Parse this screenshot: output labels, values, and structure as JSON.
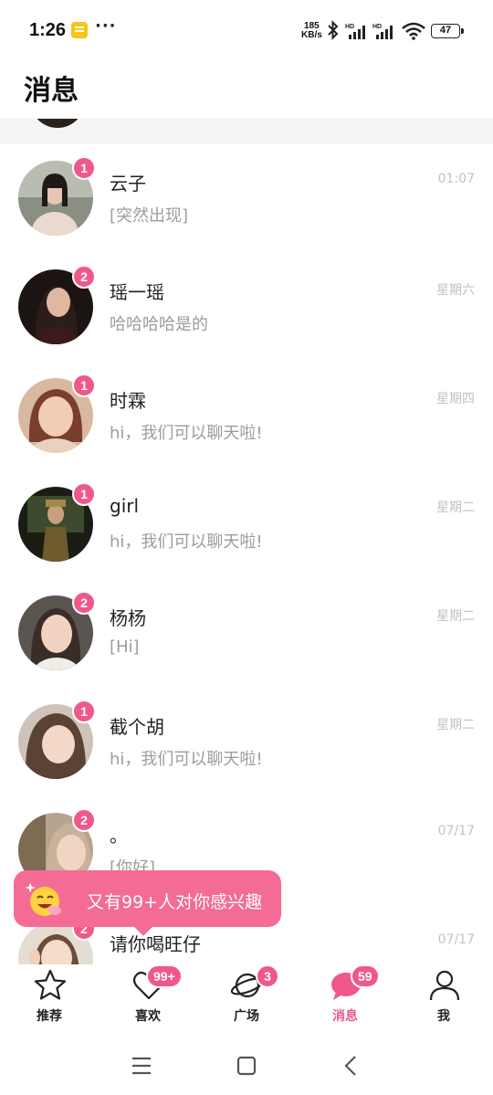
{
  "status_bar": {
    "time": "1:26",
    "dots": "···",
    "speed_value": "185",
    "speed_unit": "KB/s",
    "signal_label": "HD",
    "battery": "47"
  },
  "header": {
    "title": "消息"
  },
  "conversations": [
    {
      "name": "云子",
      "message": "[突然出现]",
      "time": "01:07",
      "unread": "1"
    },
    {
      "name": "瑶一瑶",
      "message": "哈哈哈哈是的",
      "time": "星期六",
      "unread": "2"
    },
    {
      "name": "时霖",
      "message": "hi，我们可以聊天啦!",
      "time": "星期四",
      "unread": "1"
    },
    {
      "name": "girl",
      "message": "hi，我们可以聊天啦!",
      "time": "星期二",
      "unread": "1"
    },
    {
      "name": "杨杨",
      "message": "[Hi]",
      "time": "星期二",
      "unread": "2"
    },
    {
      "name": "截个胡",
      "message": "hi，我们可以聊天啦!",
      "time": "星期二",
      "unread": "1"
    },
    {
      "name": "。",
      "message": "[你好]",
      "time": "07/17",
      "unread": "2"
    },
    {
      "name": "请你喝旺仔",
      "message": "",
      "time": "07/17",
      "unread": "2"
    }
  ],
  "toast": {
    "text": "又有99+人对你感兴趣"
  },
  "bottom_nav": {
    "items": [
      {
        "label": "推荐",
        "badge": "",
        "icon": "star-icon"
      },
      {
        "label": "喜欢",
        "badge": "99+",
        "icon": "heart-icon"
      },
      {
        "label": "广场",
        "badge": "3",
        "icon": "planet-icon"
      },
      {
        "label": "消息",
        "badge": "59",
        "icon": "chat-bubble-icon",
        "active": true
      },
      {
        "label": "我",
        "badge": "",
        "icon": "person-icon"
      }
    ],
    "active_color": "#f0588a"
  },
  "colors": {
    "accent": "#f0588a",
    "toast": "#f46b95",
    "muted_text": "#9c9c9c",
    "time_text": "#c2c2c2"
  }
}
